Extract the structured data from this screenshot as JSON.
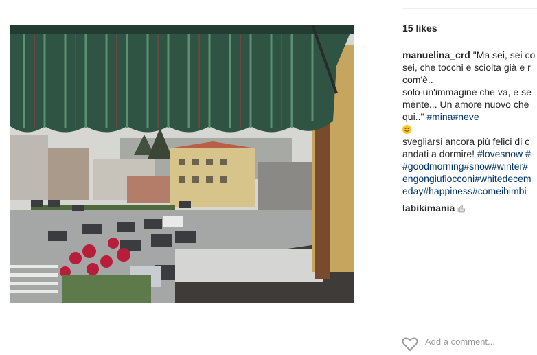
{
  "post": {
    "photo_alt": "Snowy street view from a balcony",
    "likes": "15 likes",
    "caption": {
      "username": "manuelina_crd",
      "lines": [
        "\"Ma sei, sei co",
        "sei, che tocchi e sciolta già e r",
        "com'è..",
        "solo un'immagine che va, e se",
        "mente... Un amore nuovo che",
        "qui..\""
      ],
      "hashtags_line6": "#mina#neve",
      "line8": "svegliarsi ancora più felici di c",
      "line9_text": "andati a dormire! ",
      "line9_tag": "#lovesnow #",
      "tag_lines": [
        "#goodmorning#snow#winter#",
        "engongiufiocconi#whitedecem",
        "eday#happiness#comeibimbi"
      ]
    },
    "comment": {
      "username": "labikimania",
      "emoji": "thumbs-up"
    },
    "add_comment_placeholder": "Add a comment..."
  },
  "colors": {
    "hashtag": "#003569",
    "separator": "#efefef"
  },
  "icons": {
    "emoji_smile": "smiling-face-icon",
    "like": "heart-icon"
  }
}
